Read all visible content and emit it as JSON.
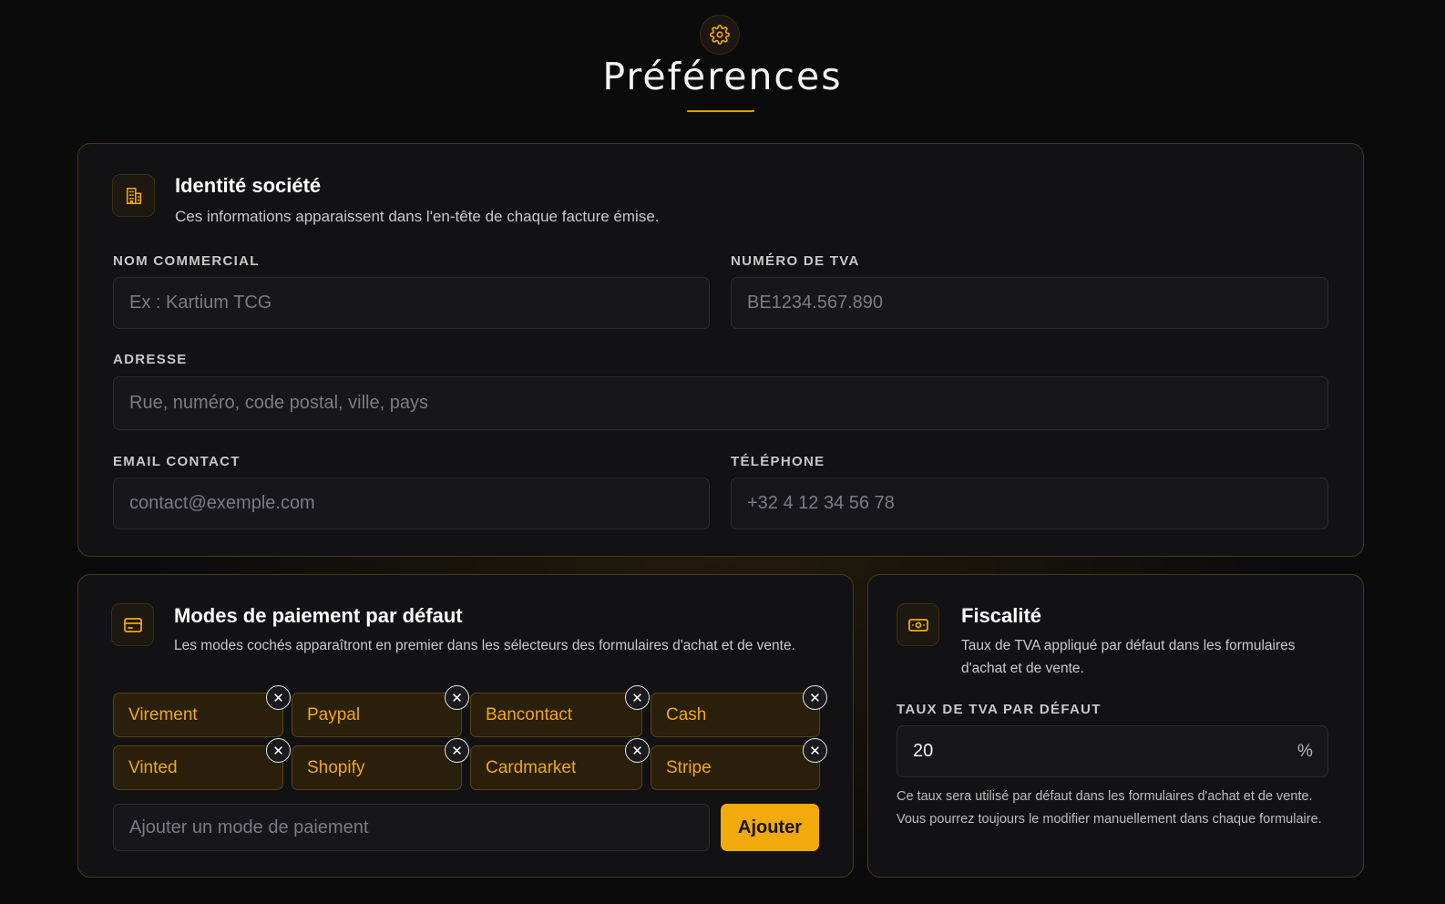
{
  "header": {
    "icon": "gear-icon",
    "title": "Préférences"
  },
  "colors": {
    "accent": "#f2a90c",
    "background": "#0b0b0c",
    "card": "#121214",
    "card_border": "#4a3814"
  },
  "identity": {
    "icon": "building-icon",
    "title": "Identité société",
    "description": "Ces informations apparaissent dans l'en-tête de chaque facture émise.",
    "fields": {
      "trade_name": {
        "label": "NOM COMMERCIAL",
        "placeholder": "Ex : Kartium TCG",
        "value": ""
      },
      "vat_number": {
        "label": "NUMÉRO DE TVA",
        "placeholder": "BE1234.567.890",
        "value": ""
      },
      "address": {
        "label": "ADRESSE",
        "placeholder": "Rue, numéro, code postal, ville, pays",
        "value": ""
      },
      "email": {
        "label": "EMAIL CONTACT",
        "placeholder": "contact@exemple.com",
        "value": ""
      },
      "phone": {
        "label": "TÉLÉPHONE",
        "placeholder": "+32 4 12 34 56 78",
        "value": ""
      }
    }
  },
  "payment": {
    "icon": "credit-card-icon",
    "title": "Modes de paiement par défaut",
    "description": "Les modes cochés apparaîtront en premier dans les sélecteurs des formulaires d'achat et de vente.",
    "methods": [
      "Virement",
      "Paypal",
      "Bancontact",
      "Cash",
      "Vinted",
      "Shopify",
      "Cardmarket",
      "Stripe"
    ],
    "remove_symbol": "✕",
    "add_input": {
      "placeholder": "Ajouter un mode de paiement",
      "value": ""
    },
    "add_button": "Ajouter"
  },
  "tax": {
    "icon": "banknote-icon",
    "title": "Fiscalité",
    "description": "Taux de TVA appliqué par défaut dans les formulaires d'achat et de vente.",
    "field": {
      "label": "TAUX DE TVA PAR DÉFAUT",
      "value": "20",
      "suffix": "%"
    },
    "help": "Ce taux sera utilisé par défaut dans les formulaires d'achat et de vente. Vous pourrez toujours le modifier manuellement dans chaque formulaire."
  }
}
